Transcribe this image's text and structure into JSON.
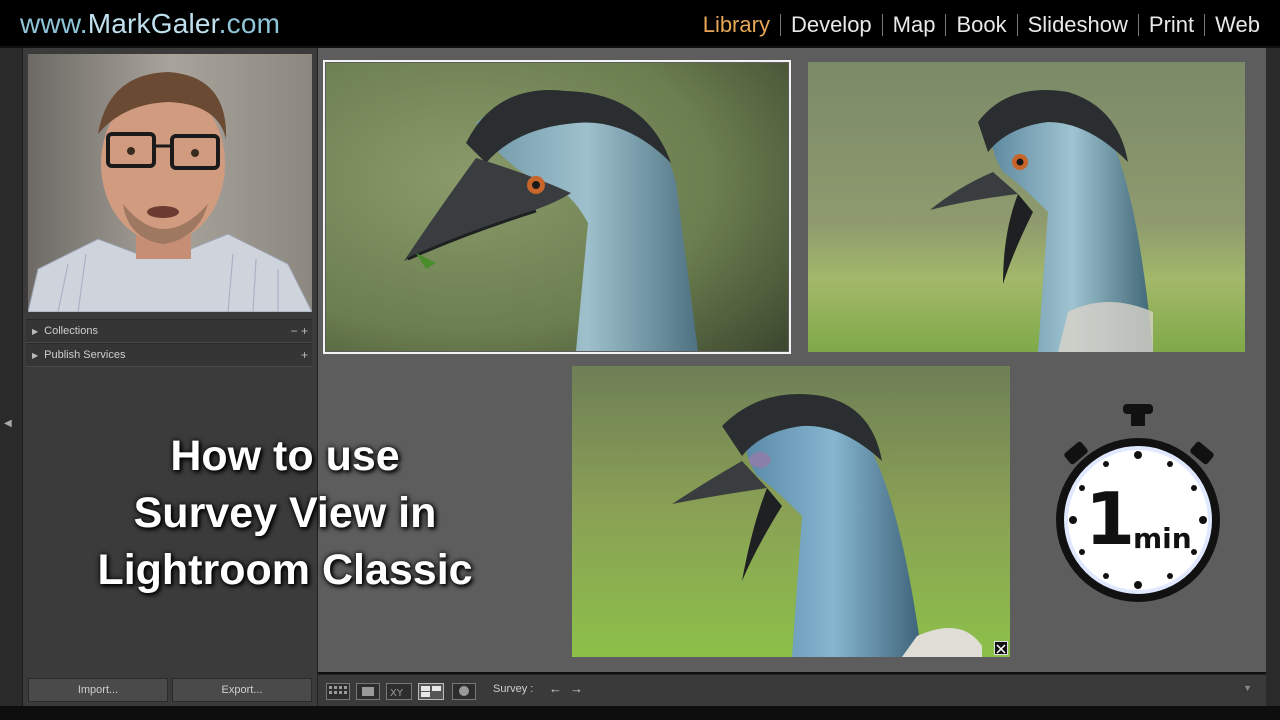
{
  "brand": {
    "prefix": "www.",
    "name": "MarkGaler",
    "suffix": ".com"
  },
  "modules": [
    {
      "label": "Library",
      "active": true
    },
    {
      "label": "Develop",
      "active": false
    },
    {
      "label": "Map",
      "active": false
    },
    {
      "label": "Book",
      "active": false
    },
    {
      "label": "Slideshow",
      "active": false
    },
    {
      "label": "Print",
      "active": false
    },
    {
      "label": "Web",
      "active": false
    }
  ],
  "left_panel": {
    "collections_label": "Collections",
    "collections_actions": "− +",
    "publish_label": "Publish Services",
    "publish_actions": "+",
    "import_label": "Import...",
    "export_label": "Export..."
  },
  "overlay_title": {
    "line1": "How to use",
    "line2": "Survey View in",
    "line3": "Lightroom Classic"
  },
  "toolbar": {
    "survey_label": "Survey :",
    "prev": "←",
    "next": "→"
  },
  "timer": {
    "number": "1",
    "unit": "min"
  },
  "colors": {
    "active_module": "#e6a655",
    "brand": "#8fc5d9",
    "main_bg": "#5d5d5d"
  }
}
